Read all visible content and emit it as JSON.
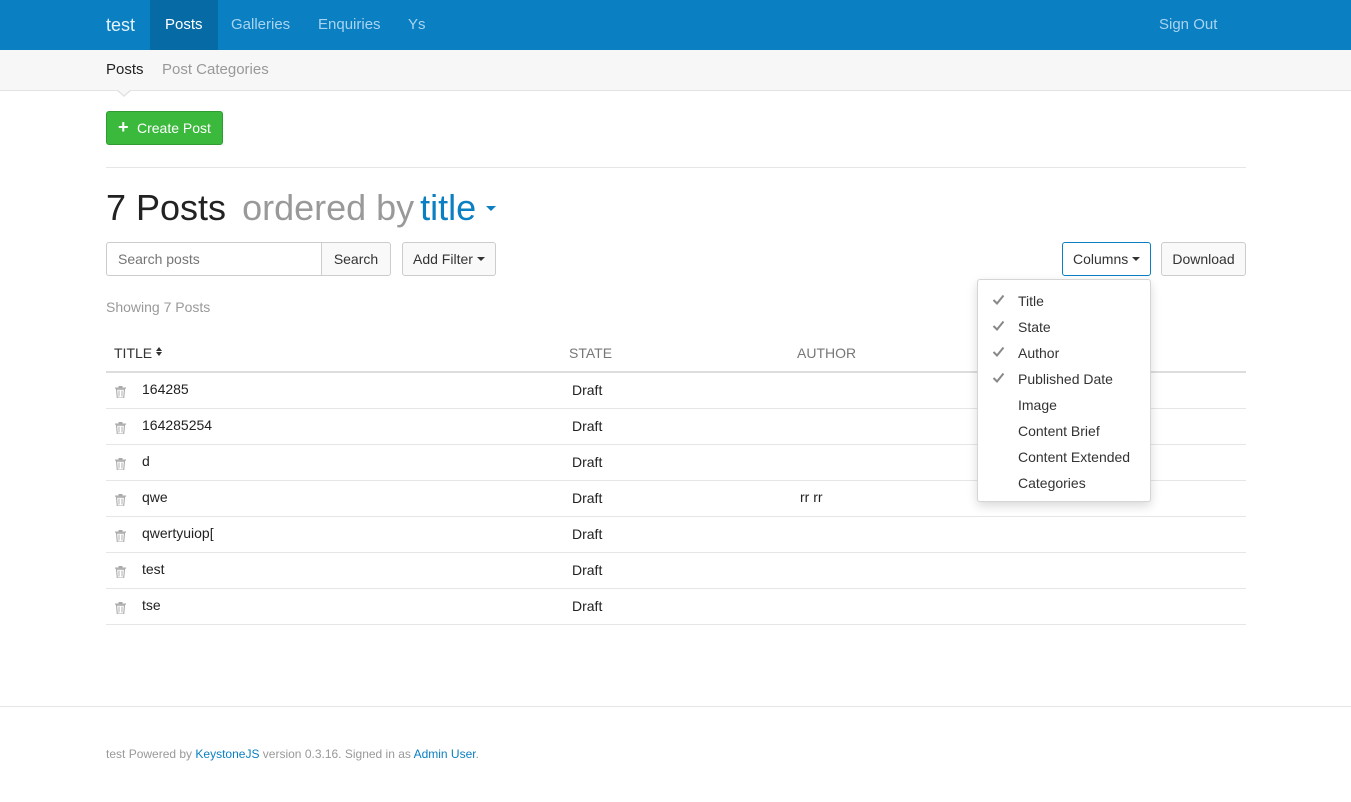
{
  "topnav": {
    "brand": "test",
    "items": [
      {
        "label": "Posts",
        "active": true
      },
      {
        "label": "Galleries",
        "active": false
      },
      {
        "label": "Enquiries",
        "active": false
      },
      {
        "label": "Ys",
        "active": false
      }
    ],
    "signout": "Sign Out"
  },
  "subnav": {
    "items": [
      {
        "label": "Posts",
        "active": true
      },
      {
        "label": "Post Categories",
        "active": false
      }
    ]
  },
  "toolbar": {
    "create_label": "Create Post",
    "search_placeholder": "Search posts",
    "search_button": "Search",
    "filter_button": "Add Filter",
    "columns_button": "Columns",
    "download_button": "Download"
  },
  "heading": {
    "count": "7 Posts",
    "ordered_by": "ordered by",
    "sort_field": "title"
  },
  "showing": "Showing 7 Posts",
  "table": {
    "headers": {
      "title": "Title",
      "state": "State",
      "author": "Author"
    },
    "rows": [
      {
        "title": "164285",
        "state": "Draft",
        "author": ""
      },
      {
        "title": "164285254",
        "state": "Draft",
        "author": ""
      },
      {
        "title": "d",
        "state": "Draft",
        "author": ""
      },
      {
        "title": "qwe",
        "state": "Draft",
        "author": "rr rr"
      },
      {
        "title": "qwertyuiop[",
        "state": "Draft",
        "author": ""
      },
      {
        "title": "test",
        "state": "Draft",
        "author": ""
      },
      {
        "title": "tse",
        "state": "Draft",
        "author": ""
      }
    ]
  },
  "columns_menu": {
    "items": [
      {
        "label": "Title",
        "checked": true
      },
      {
        "label": "State",
        "checked": true
      },
      {
        "label": "Author",
        "checked": true
      },
      {
        "label": "Published Date",
        "checked": true
      },
      {
        "label": "Image",
        "checked": false
      },
      {
        "label": "Content Brief",
        "checked": false
      },
      {
        "label": "Content Extended",
        "checked": false
      },
      {
        "label": "Categories",
        "checked": false
      }
    ]
  },
  "footer": {
    "site": "test",
    "powered_by": "Powered by",
    "framework": "KeystoneJS",
    "version": "version 0.3.16. Signed in as",
    "user": "Admin User",
    "end": "."
  },
  "colors": {
    "primary": "#0a7fc2",
    "success": "#3bb93d",
    "muted": "#999999"
  },
  "icons": {
    "row_action": "trash-icon",
    "check": "check-icon",
    "create": "plus-icon"
  }
}
